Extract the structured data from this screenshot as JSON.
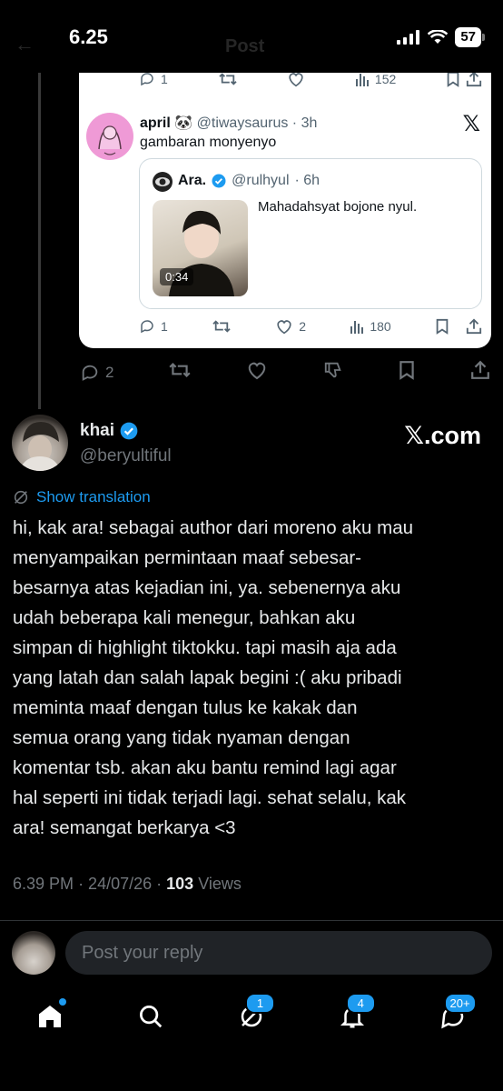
{
  "status_bar": {
    "time": "6.25",
    "battery": "57"
  },
  "header": {
    "ghost_title": "Post"
  },
  "screenshot": {
    "top_actions": {
      "replies": "1",
      "views": "152"
    },
    "author": {
      "name": "april",
      "emoji": "🐼",
      "handle": "@tiwaysaurus",
      "time": "· 3h"
    },
    "body": "gambaran monyenyo",
    "quote": {
      "name": "Ara.",
      "handle": "@rulhyul",
      "time": "· 6h",
      "text": "Mahadahsyat bojone nyul.",
      "duration": "0:34"
    },
    "actions": {
      "replies": "1",
      "likes": "2",
      "views": "180"
    }
  },
  "parent_actions": {
    "replies": "2"
  },
  "tweet": {
    "name": "khai",
    "handle": "@beryultiful",
    "brand": "𝕏.com",
    "translate_label": "Show translation",
    "text": "hi, kak ara! sebagai author dari moreno aku mau\nmenyampaikan permintaan maaf sebesar-\nbesarnya atas kejadian ini, ya. sebenernya aku\nudah beberapa kali menegur, bahkan aku\nsimpan di highlight tiktokku. tapi masih aja ada\nyang latah dan salah lapak begini :( aku pribadi\nmeminta maaf dengan tulus ke kakak dan\nsemua orang yang tidak nyaman dengan\nkomentar tsb. akan aku bantu remind lagi agar\nhal seperti ini tidak terjadi lagi. sehat selalu, kak\nara! semangat berkarya <3",
    "time": "6.39 PM",
    "date": "· 24/07/26 ·",
    "views_count": "103",
    "views_label": "Views"
  },
  "reply": {
    "placeholder": "Post your reply"
  },
  "nav": {
    "messages_badge": "1",
    "notifications_badge": "4",
    "communities_badge": "20+"
  },
  "colors": {
    "accent": "#1d9bf0",
    "background": "#000000",
    "muted": "#71767b"
  }
}
